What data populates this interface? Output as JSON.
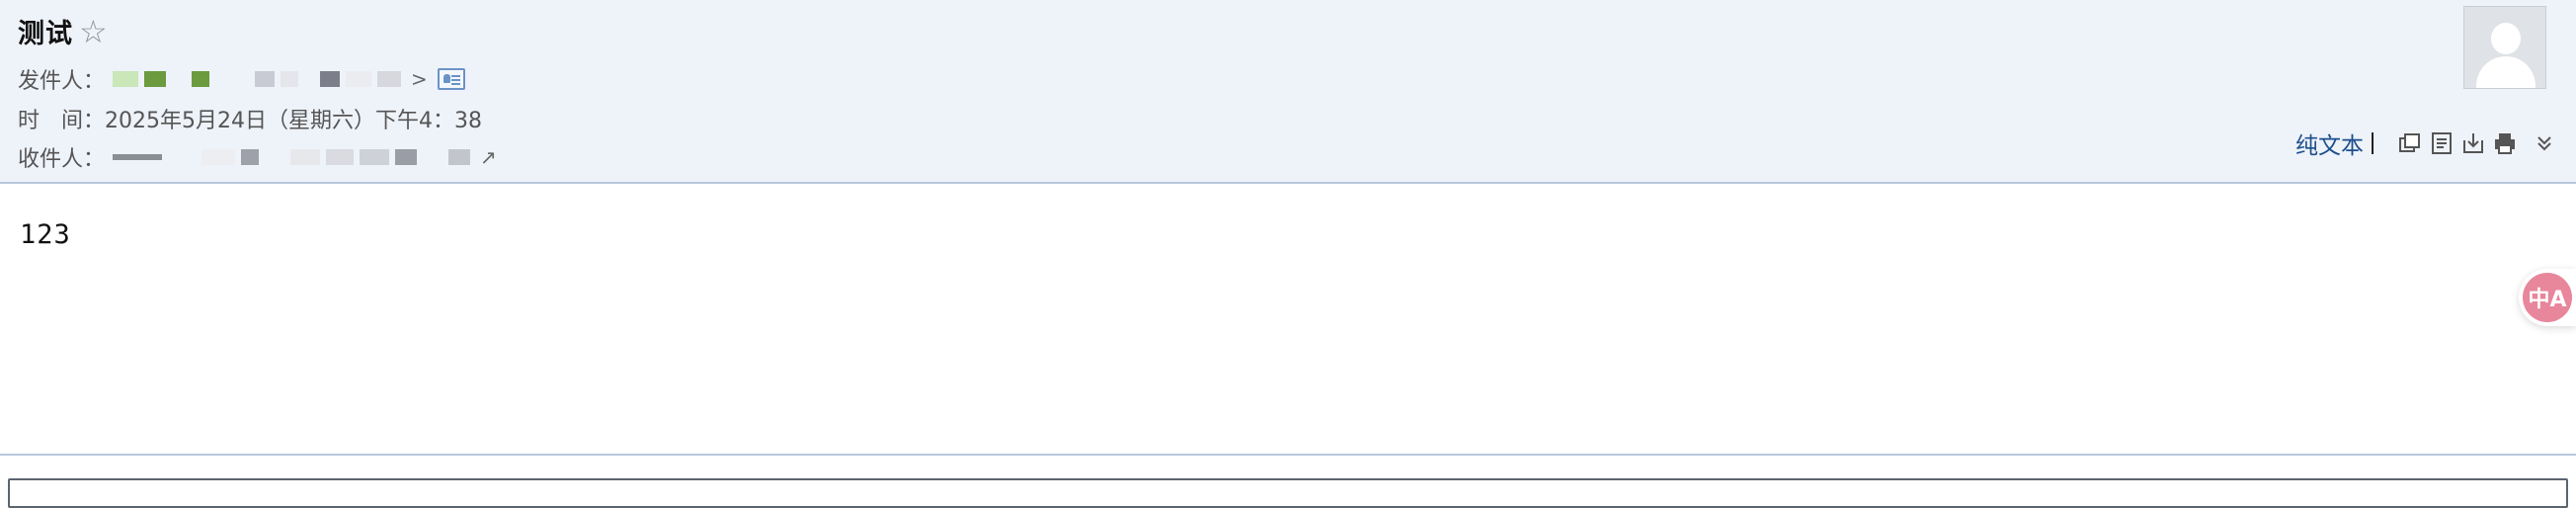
{
  "mail": {
    "subject": "测试",
    "star_icon": "☆",
    "sender": {
      "label": "发件人：",
      "redacted": true
    },
    "time": {
      "label": "时　间：",
      "value": "2025年5月24日（星期六）下午4：38"
    },
    "recipient": {
      "label": "收件人：",
      "redacted": true
    },
    "body": "123"
  },
  "toolbar": {
    "plain_text_label": "纯文本",
    "icons": [
      "new-window-icon",
      "text-view-icon",
      "download-icon",
      "print-icon",
      "expand-icon"
    ]
  },
  "translate": {
    "label": "中A"
  },
  "colors": {
    "header_bg": "#eef2f9",
    "link": "#1c4f8c",
    "translate": "#e8869b"
  }
}
